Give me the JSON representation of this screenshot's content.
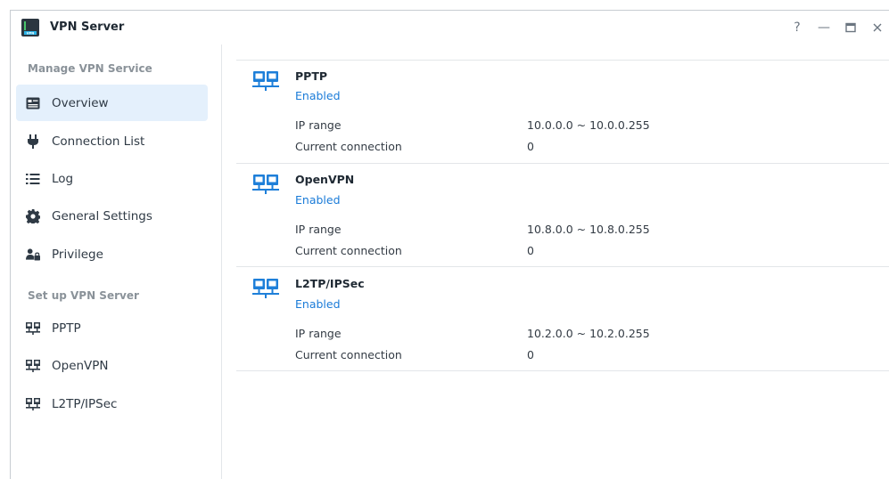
{
  "window": {
    "title": "VPN Server"
  },
  "controls": {
    "help": "?",
    "minimize": "—",
    "maximize": "❐",
    "close": "✕"
  },
  "sidebar": {
    "manage_header": "Manage VPN Service",
    "manage_items": [
      {
        "label": "Overview",
        "icon": "overview-icon"
      },
      {
        "label": "Connection List",
        "icon": "plug-icon"
      },
      {
        "label": "Log",
        "icon": "list-icon"
      },
      {
        "label": "General Settings",
        "icon": "gear-icon"
      },
      {
        "label": "Privilege",
        "icon": "users-lock-icon"
      }
    ],
    "setup_header": "Set up VPN Server",
    "setup_items": [
      {
        "label": "PPTP",
        "icon": "network-icon"
      },
      {
        "label": "OpenVPN",
        "icon": "network-icon"
      },
      {
        "label": "L2TP/IPSec",
        "icon": "network-icon"
      }
    ]
  },
  "services": [
    {
      "name": "PPTP",
      "status": "Enabled",
      "ip_range_label": "IP range",
      "ip_range": "10.0.0.0 ~ 10.0.0.255",
      "connection_label": "Current connection",
      "connection": "0"
    },
    {
      "name": "OpenVPN",
      "status": "Enabled",
      "ip_range_label": "IP range",
      "ip_range": "10.8.0.0 ~ 10.8.0.255",
      "connection_label": "Current connection",
      "connection": "0"
    },
    {
      "name": "L2TP/IPSec",
      "status": "Enabled",
      "ip_range_label": "IP range",
      "ip_range": "10.2.0.0 ~ 10.2.0.255",
      "connection_label": "Current connection",
      "connection": "0"
    }
  ],
  "colors": {
    "accent": "#1a7bd8",
    "active_bg": "#e4f0fc",
    "icon_blue": "#1e7fd9"
  }
}
